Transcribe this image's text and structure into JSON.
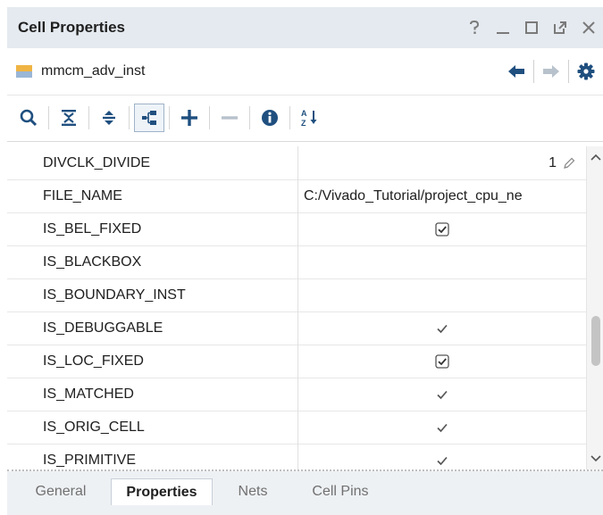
{
  "window": {
    "title": "Cell Properties",
    "controls": [
      "help-icon",
      "minimize-icon",
      "maximize-icon",
      "float-icon",
      "close-icon"
    ]
  },
  "object": {
    "name": "mmcm_adv_inst"
  },
  "toolbar": [
    "search-icon",
    "collapse-all-icon",
    "expand-all-icon",
    "show-hierarchy-icon",
    "add-icon",
    "remove-icon",
    "info-icon",
    "sort-az-icon"
  ],
  "properties": [
    {
      "name": "DIVCLK_DIVIDE",
      "value": "1",
      "kind": "editable"
    },
    {
      "name": "FILE_NAME",
      "value": "C:/Vivado_Tutorial/project_cpu_ne",
      "kind": "text"
    },
    {
      "name": "IS_BEL_FIXED",
      "value": "",
      "kind": "checkbox-checked"
    },
    {
      "name": "IS_BLACKBOX",
      "value": "",
      "kind": "empty"
    },
    {
      "name": "IS_BOUNDARY_INST",
      "value": "",
      "kind": "empty"
    },
    {
      "name": "IS_DEBUGGABLE",
      "value": "",
      "kind": "check"
    },
    {
      "name": "IS_LOC_FIXED",
      "value": "",
      "kind": "checkbox-checked"
    },
    {
      "name": "IS_MATCHED",
      "value": "",
      "kind": "check"
    },
    {
      "name": "IS_ORIG_CELL",
      "value": "",
      "kind": "check"
    },
    {
      "name": "IS_PRIMITIVE",
      "value": "",
      "kind": "check"
    }
  ],
  "tabs": [
    {
      "label": "General",
      "active": false
    },
    {
      "label": "Properties",
      "active": true
    },
    {
      "label": "Nets",
      "active": false
    },
    {
      "label": "Cell Pins",
      "active": false
    }
  ],
  "colors": {
    "header_bg": "#e5eaf0",
    "icon_blue": "#1f4f7f",
    "tabs_bg": "#eef1f4"
  }
}
